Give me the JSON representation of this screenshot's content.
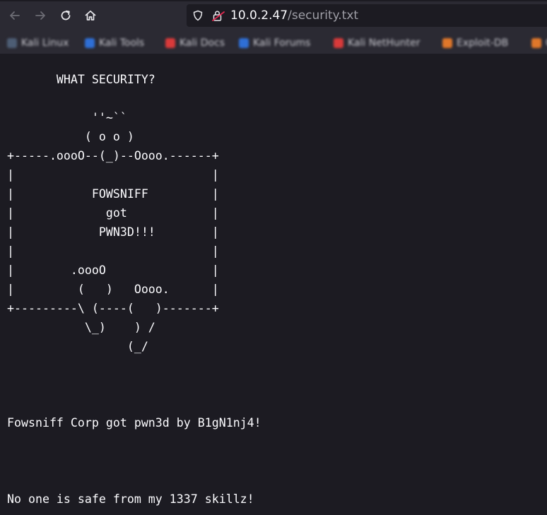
{
  "browser": {
    "url_host": "10.0.2.47",
    "url_path": "/security.txt",
    "bookmarks": [
      {
        "label": "Kali Linux",
        "color": "#4d5d74"
      },
      {
        "label": "Kali Tools",
        "color": "#2f6fd6"
      },
      {
        "label": "Kali Docs",
        "color": "#d93a3a"
      },
      {
        "label": "Kali Forums",
        "color": "#2f6fd6"
      },
      {
        "label": "Kali NetHunter",
        "color": "#d93a3a"
      },
      {
        "label": "Exploit-DB",
        "color": "#e0772a"
      },
      {
        "label": "G",
        "color": "#e0772a"
      }
    ]
  },
  "page": {
    "lines": [
      "       WHAT SECURITY?",
      "",
      "            ''~``",
      "           ( o o )",
      "+-----.oooO--(_)--Oooo.------+",
      "|                            |",
      "|           FOWSNIFF         |",
      "|             got            |",
      "|            PWN3D!!!        |",
      "|                            |",
      "|        .oooO               |",
      "|         (   )   Oooo.      |",
      "+---------\\ (----(   )-------+",
      "           \\_)    ) /",
      "                 (_/",
      "",
      "",
      "",
      "Fowsniff Corp got pwn3d by B1gN1nj4!",
      "",
      "",
      "",
      "No one is safe from my 1337 skillz!"
    ]
  }
}
